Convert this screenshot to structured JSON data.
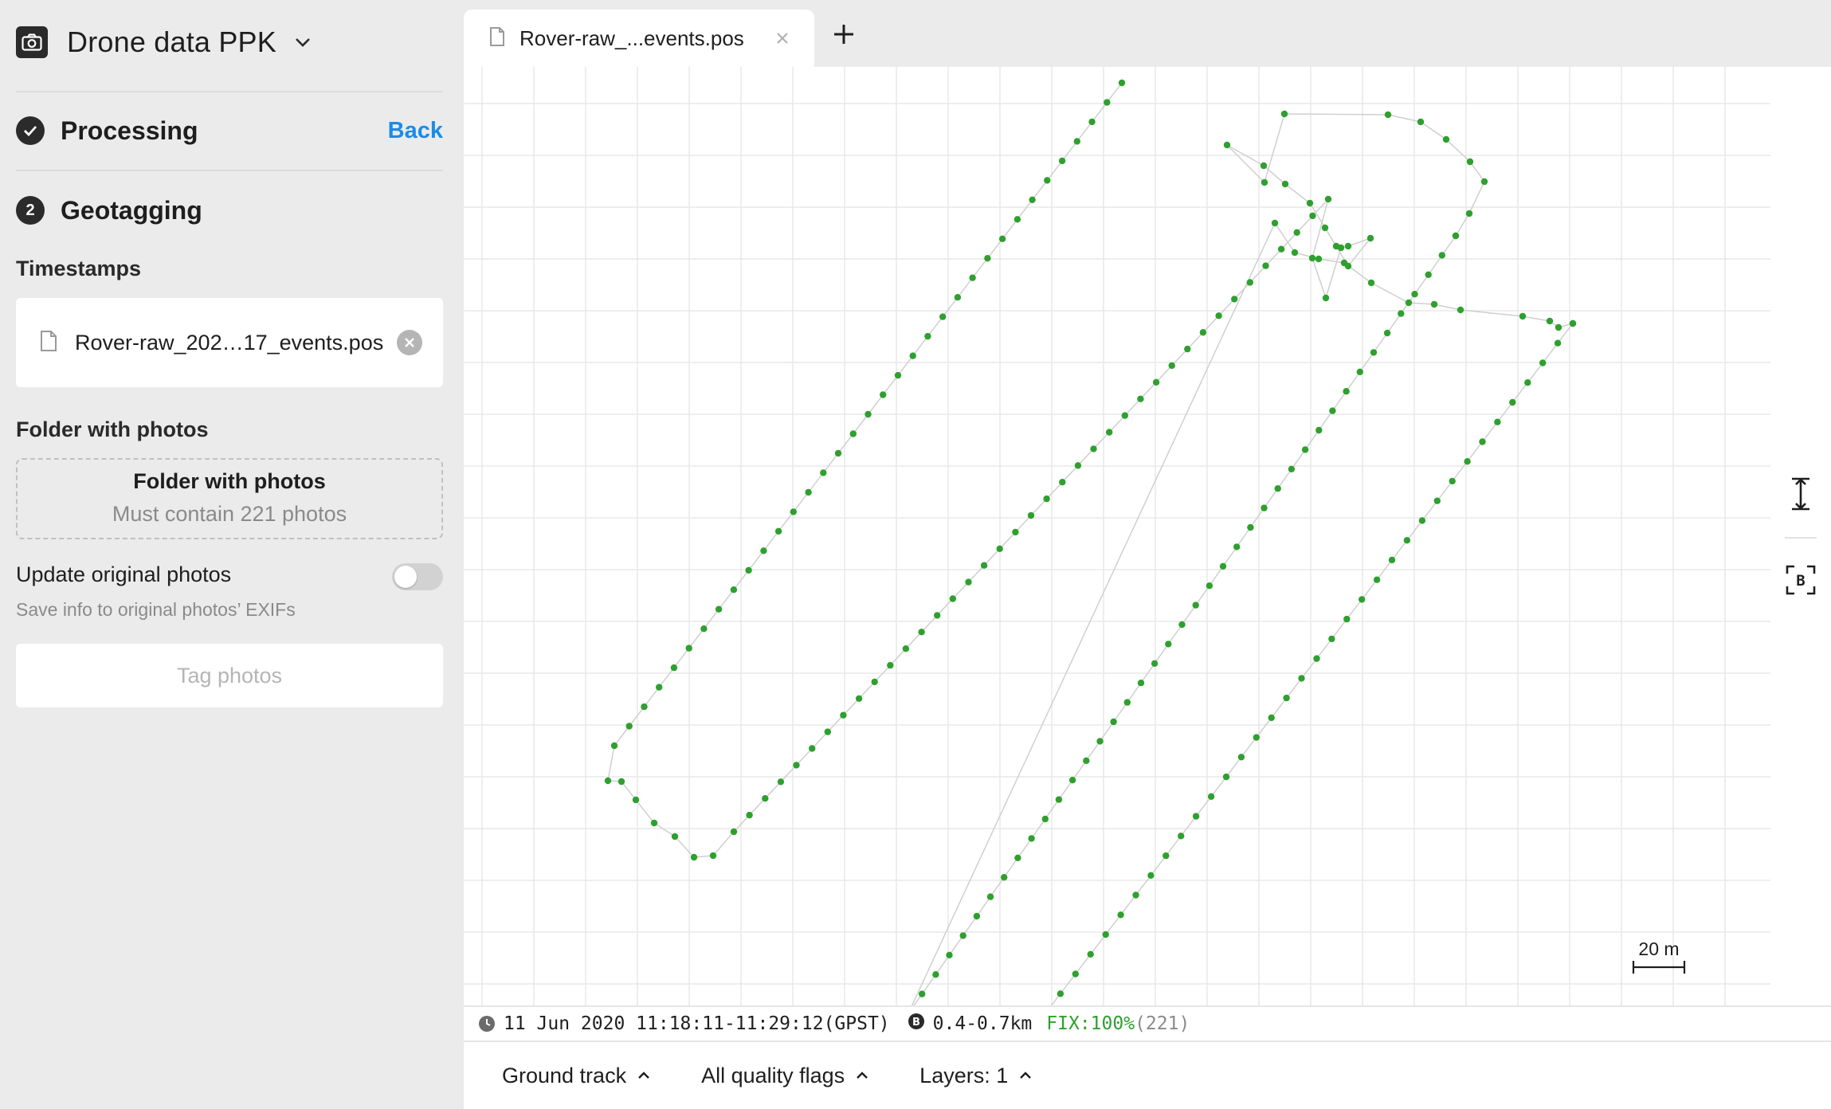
{
  "project": {
    "title": "Drone data PPK",
    "camera_icon": "camera-icon",
    "dropdown_icon": "chevron-down-icon"
  },
  "steps": {
    "processing": {
      "title": "Processing",
      "status": "done",
      "back_label": "Back"
    },
    "geotagging": {
      "number": "2",
      "title": "Geotagging"
    }
  },
  "timestamps": {
    "label": "Timestamps",
    "file_name": "Rover-raw_202…17_events.pos"
  },
  "photos": {
    "label": "Folder with photos",
    "drop_title": "Folder with photos",
    "drop_subtitle": "Must contain 221 photos"
  },
  "update_original": {
    "label": "Update original photos",
    "description": "Save info to original photos’ EXIFs",
    "enabled": false
  },
  "tag_button": {
    "label": "Tag photos",
    "enabled": false
  },
  "tabs": [
    {
      "label": "Rover-raw_...events.pos",
      "active": true
    }
  ],
  "map": {
    "scale_label": "20 m",
    "track_color": "#2ea02e",
    "fix_color": "#2ea02e",
    "tools": [
      "fit-height-icon",
      "base-station-icon"
    ]
  },
  "status": {
    "time_range": "11 Jun 2020 11:18:11-11:29:12(GPST)",
    "base_distance": "0.4-0.7km",
    "fix": "FIX:100%",
    "count": "(221)"
  },
  "bottom": {
    "ground_track": "Ground track",
    "quality_flags": "All quality flags",
    "layers": "Layers: 1"
  }
}
